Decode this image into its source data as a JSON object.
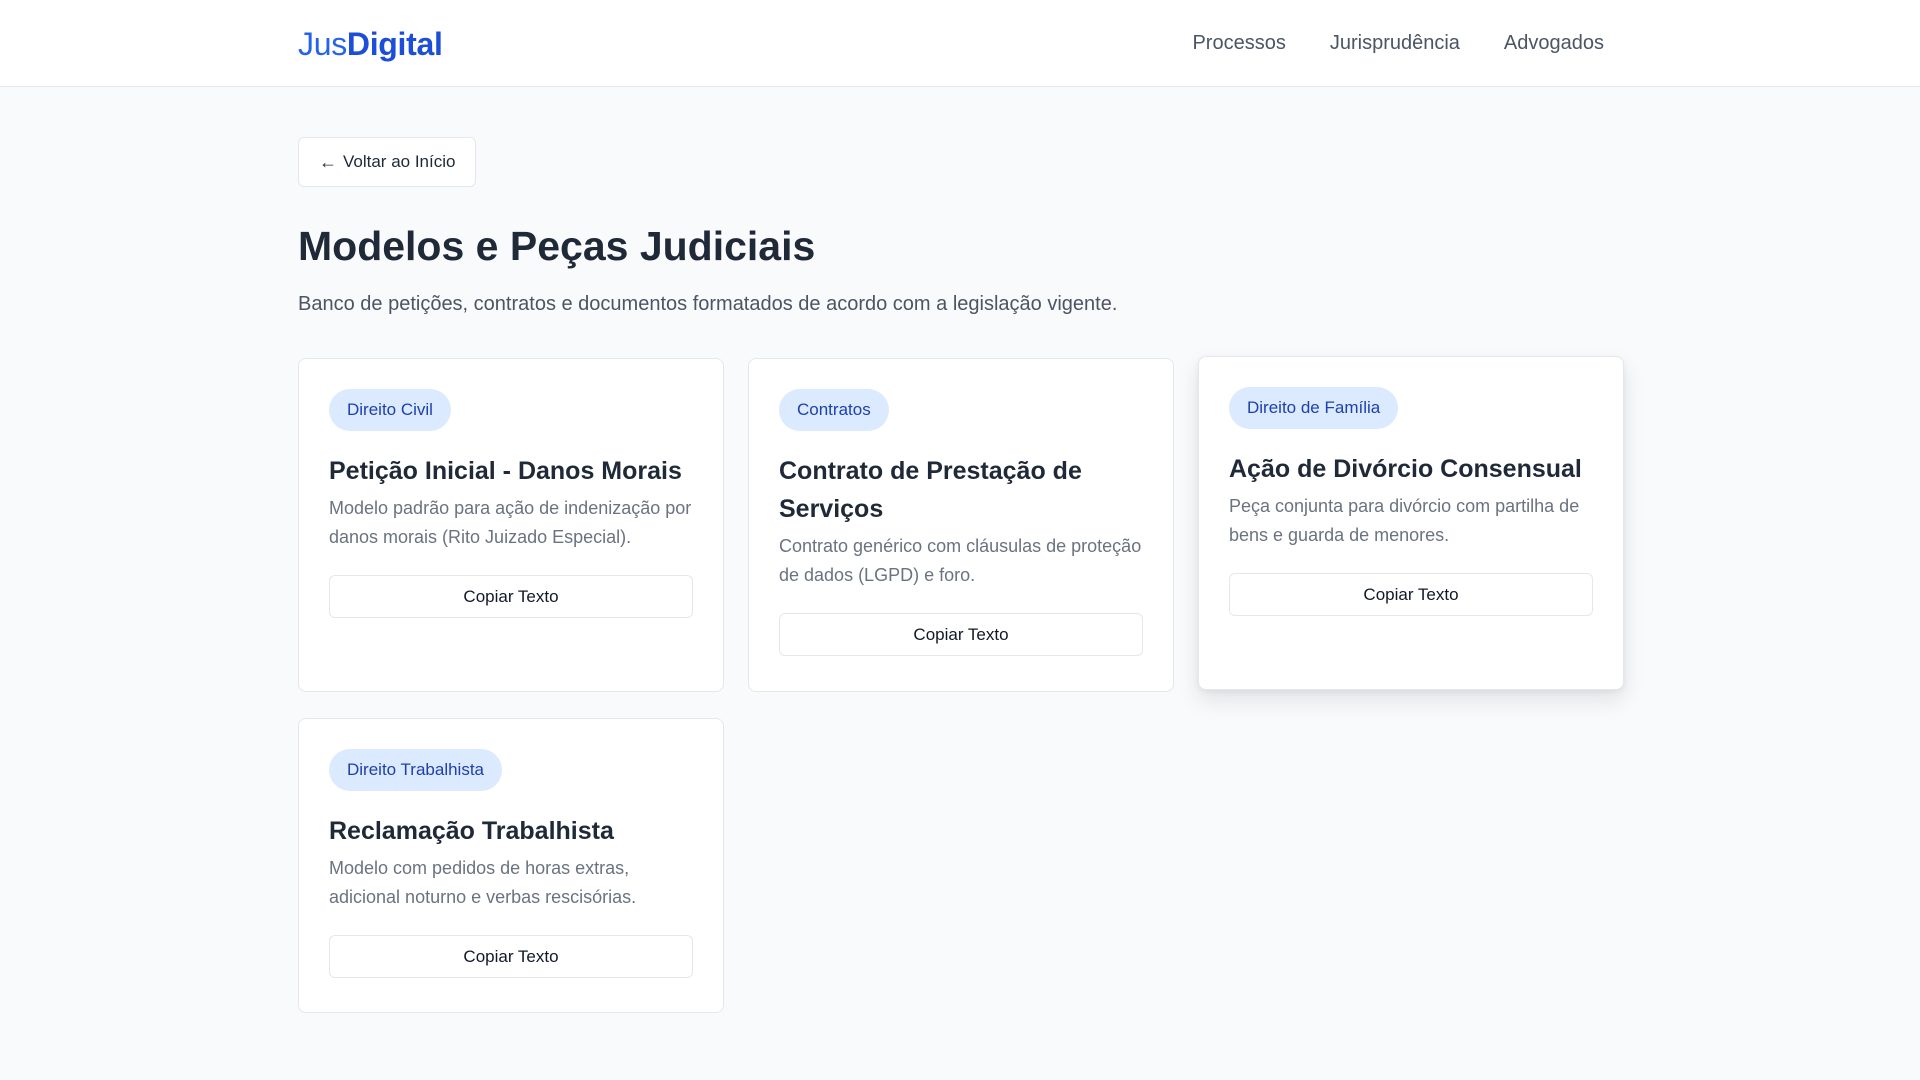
{
  "loading_bar": {
    "progress": 0.2
  },
  "header": {
    "logo": {
      "part1": "Jus",
      "part2": "Digital"
    },
    "nav": [
      {
        "label": "Processos"
      },
      {
        "label": "Jurisprudência"
      },
      {
        "label": "Advogados"
      }
    ]
  },
  "page": {
    "back_label": "Voltar ao Início",
    "back_arrow": "←",
    "title": "Modelos e Peças Judiciais",
    "subtitle": "Banco de petições, contratos e documentos formatados de acordo com a legislação vigente."
  },
  "cards": [
    {
      "tag": "Direito Civil",
      "title": "Petição Inicial - Danos Morais",
      "description": "Modelo padrão para ação de indenização por danos morais (Rito Juizado Especial).",
      "button": "Copiar Texto"
    },
    {
      "tag": "Contratos",
      "title": "Contrato de Prestação de Serviços",
      "description": "Contrato genérico com cláusulas de proteção de dados (LGPD) e foro.",
      "button": "Copiar Texto"
    },
    {
      "tag": "Direito de Família",
      "title": "Ação de Divórcio Consensual",
      "description": "Peça conjunta para divórcio com partilha de bens e guarda de menores.",
      "button": "Copiar Texto"
    },
    {
      "tag": "Direito Trabalhista",
      "title": "Reclamação Trabalhista",
      "description": "Modelo com pedidos de horas extras, adicional noturno e verbas rescisórias.",
      "button": "Copiar Texto"
    }
  ],
  "colors": {
    "brand": "#2563eb",
    "tag_bg": "#dbeafe",
    "tag_text": "#1e40af",
    "progress": "#22c55e"
  }
}
